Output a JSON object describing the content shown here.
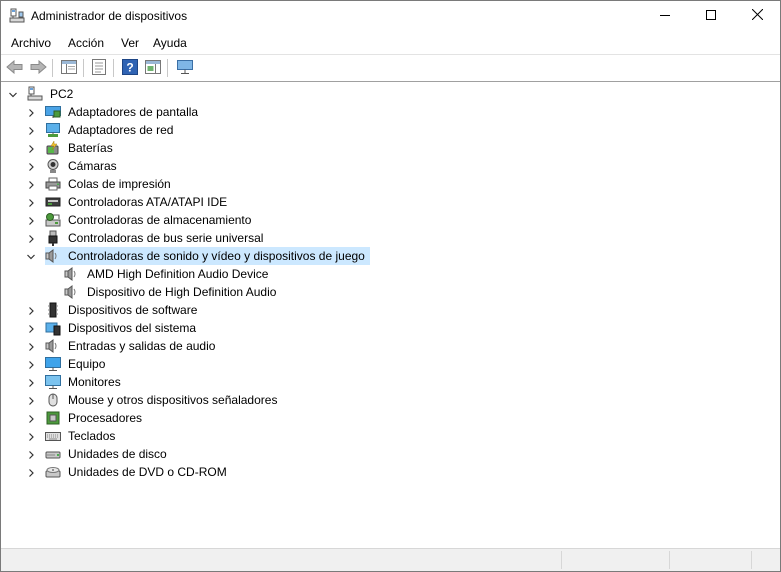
{
  "window": {
    "title": "Administrador de dispositivos"
  },
  "menu": {
    "archivo": "Archivo",
    "accion": "Acción",
    "ver": "Ver",
    "ayuda": "Ayuda"
  },
  "tree": {
    "root": "PC2",
    "categories": [
      {
        "label": "Adaptadores de pantalla",
        "icon": "display-adapter-icon"
      },
      {
        "label": "Adaptadores de red",
        "icon": "network-adapter-icon"
      },
      {
        "label": "Baterías",
        "icon": "battery-icon"
      },
      {
        "label": "Cámaras",
        "icon": "camera-icon"
      },
      {
        "label": "Colas de impresión",
        "icon": "printer-icon"
      },
      {
        "label": "Controladoras ATA/ATAPI IDE",
        "icon": "ide-controller-icon"
      },
      {
        "label": "Controladoras de almacenamiento",
        "icon": "storage-controller-icon"
      },
      {
        "label": "Controladoras de bus serie universal",
        "icon": "usb-icon"
      },
      {
        "label": "Controladoras de sonido y vídeo y dispositivos de juego",
        "icon": "speaker-icon",
        "expanded": true,
        "selected": true
      },
      {
        "label": "Dispositivos de software",
        "icon": "software-device-icon"
      },
      {
        "label": "Dispositivos del sistema",
        "icon": "system-device-icon"
      },
      {
        "label": "Entradas y salidas de audio",
        "icon": "speaker-icon"
      },
      {
        "label": "Equipo",
        "icon": "computer-icon"
      },
      {
        "label": "Monitores",
        "icon": "monitor-icon"
      },
      {
        "label": "Mouse y otros dispositivos señaladores",
        "icon": "mouse-icon"
      },
      {
        "label": "Procesadores",
        "icon": "processor-icon"
      },
      {
        "label": "Teclados",
        "icon": "keyboard-icon"
      },
      {
        "label": "Unidades de disco",
        "icon": "disk-drive-icon"
      },
      {
        "label": "Unidades de DVD o CD-ROM",
        "icon": "dvd-drive-icon"
      }
    ],
    "sound_children": [
      "AMD High Definition Audio Device",
      "Dispositivo de High Definition Audio"
    ]
  },
  "colors": {
    "selection": "#cce8ff",
    "toolbar_border": "#a0a0a0",
    "statusbar": "#f0f0f0"
  }
}
